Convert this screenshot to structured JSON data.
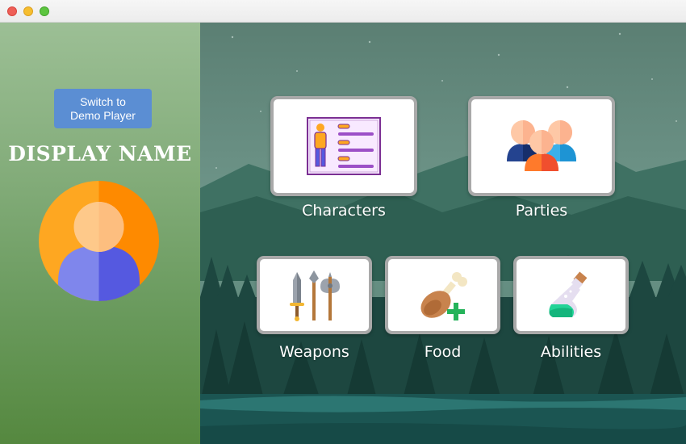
{
  "window": {
    "controls": [
      "close",
      "minimize",
      "maximize"
    ]
  },
  "sidebar": {
    "switch_button_line1": "Switch to",
    "switch_button_line2": "Demo Player",
    "display_name": "DISPLAY NAME",
    "avatar_icon": "user-avatar-icon"
  },
  "menu": {
    "characters": {
      "label": "Characters",
      "icon": "character-sheet-icon"
    },
    "parties": {
      "label": "Parties",
      "icon": "group-icon"
    },
    "weapons": {
      "label": "Weapons",
      "icon": "weapons-icon"
    },
    "food": {
      "label": "Food",
      "icon": "food-icon"
    },
    "abilities": {
      "label": "Abilities",
      "icon": "potion-icon"
    }
  },
  "colors": {
    "switch_button": "#5b8ed3",
    "sidebar_top": "#9cbf95",
    "sidebar_bottom": "#55883f",
    "tile_border": "#a9a9a9"
  }
}
